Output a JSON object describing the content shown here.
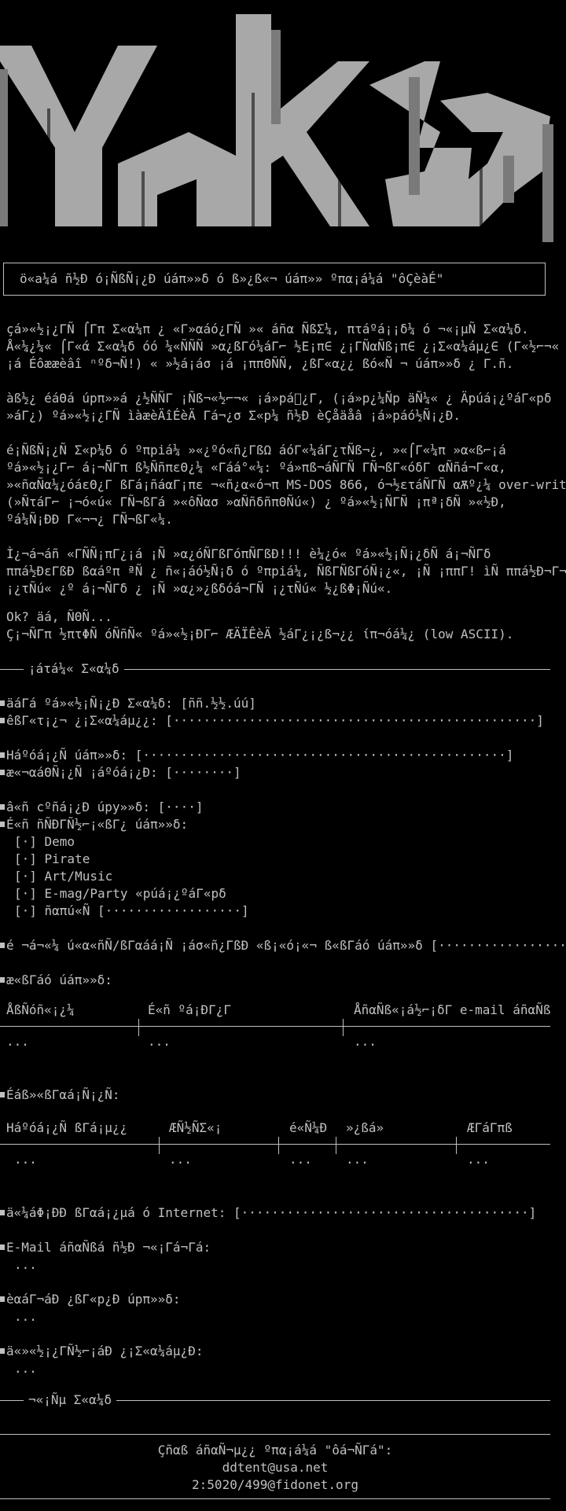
{
  "title": "ö«a¼á ñ½Ð ó¡ÑßÑ¡¿Ð úáπ»»δ ó ß»¿ß«¬ úáπ»» ºπα¡á¼á \"ôÇèàÉ\"",
  "intro": [
    "çá»«½¡¿ΓÑ ⌠Γπ Σ«α¼π ¿ «Γ»αáó¿ΓÑ »« áñα ÑßΣ¼, πτáºá¡¡δ¼ ó ¬«¡µÑ Σ«α¼δ.",
    "Å«¼¿¼« ⌠Γ«ά Σ«α¼δ óó ¼«ÑÑÑ »α¿ßΓó¼áΓ⌐ ½Ε¡π∈ ¿¡ΓÑαÑß¡π∈ ¿¡Σ«α¼áµ¿∈ (Γ«½⌐¬«",
    "¡á Éôææèâî ⁿºδ¬Ñ!) « »½á¡áσ ¡á ¡ππΘÑÑ, ¿ßΓ«α¿¿ ßó«Ñ ¬ úáπ»»δ ¿ Γ.ñ.",
    "",
    "àß½¿ éáΘá úpπ»»á ¿½ÑÑΓ ¡Ñß¬«½⌐¬« ¡á»pá󽄡¿Γ, (¡á»p¿¼Ñp äÑ¼« ¿ Äpúá¡¿ºáΓ«pδ",
    "»áΓ¿) ºá»«½¡¿ΓÑ ìàæèÄîÉèÄ Γá¬¿σ Σ«p¼ ñ½Ð èÇåäåâ ¡á»páó½Ñ¡¿Ð.",
    "",
    "é¡ÑßÑ¡¿Ñ Σ«p¼δ ó ºπpiá¼ »«¿ºó«ñ¿ΓßΩ áóΓ«¼áΓ¿τÑß¬¿, »«⌠Γ«¼π »α«ß⌐¡á",
    "ºá»«½¡¿Γ⌐ á¡¬ÑΓπ ß½ÑñπεΘ¿¼ «Γáá°«¼: ºá»πß¬áÑΓÑ ΓÑ¬ßΓ«óδΓ αÑñá¬Γ«α,",
    "»«ñαÑα¼¿óáεΘ¿Γ ßΓá¡ñáαΓ¡πε ¬«ñ¿α«ó¬π MS-DOS 866, ó¬½ετáÑΓÑ αѪº¿¼ over-write",
    "(»ÑτáΓ⌐ ¡¬ó«ú« ΓÑ¬ßΓá »«ôÑασ »αÑñδñπΘÑú«) ¿ ºá»«½¡ÑΓÑ ¡πª¡δÑ »«½Ð,",
    "ºá¼Ñ¡ÐÐ Γ«¬¬¿ ΓÑ¬ßΓ«¼."
  ],
  "warn": [
    "Ì¿¬á¬áñ «ΓÑÑ¡πΓ¿¡á ¡Ñ »α¿óÑΓßΓóπÑΓßÐ!!! è¼¿ó« ºá»«½¡Ñ¡¿δÑ á¡¬ÑΓδ",
    "ππá½ÐεΓßÐ ßαáºπ ªÑ ¿ ñ«¡áó½Ñ¡δ ó ºπpiá¼, ÑßΓÑßΓóÑ¡¿«, ¡Ñ ¡ππΓ! ìÑ ππá½Ð¬Γ¬Ñ",
    "¡¿τÑú« ¿º á¡¬ÑΓδ ¿ ¡Ñ »α¿»¿ßδóá¬ΓÑ ¡¿τÑú« ½¿ßΦ¡Ñú«."
  ],
  "ok": [
    "Ok? äá, ÑΘÑ...",
    "Ç¡¬ÑΓπ ½πτΦÑ óÑñÑ« ºá»«½¡ÐΓ⌐ ÆÄÏÊèÄ ½áΓ¿¡¿ß¬¿¿ ίπ¬óá¼¿ (low ASCII)."
  ],
  "section1": "¡áτá¼« Σ«α¼δ",
  "fields": {
    "format": "äáΓá ºá»«½¡Ñ¡¿Ð Σ«α¼δ: [ññ.½½.úú]",
    "version": "êßΓ«τ¡¿¬ ¿¡Σ«α¼áµ¿¿: [",
    "group_name": "Háºóá¡¿Ñ úáπ»»δ: [",
    "country": "æ«¬αáΘÑ¡¿Ñ ¡áºóá¡¿Ð: [",
    "year": "â«ñ cºñá¡¿Ð úpy»»δ: [",
    "type": "É«ñ ñÑÐΓÑ½⌐¡«ßΓ¿ úáπ»»δ:",
    "options": [
      "[·] Demo",
      "[·] Pirate",
      "[·] Art/Music",
      "[·] E-mag/Party «púá¡¿ºáΓ«pδ",
      "[·] ñαπú«Ñ ["
    ],
    "members_q": "é ¬á¬«¼ ú«α«ñÑ/ßΓαáá¡Ñ ¡áσ«ñ¿ΓßÐ «ß¡«ó¡«¬ ß«ßΓáó úáπ»»δ [",
    "composition": "æ«ßΓáó úáπ»»δ:",
    "col1": [
      "ÅßÑóñ«¡¿¼",
      "É«ñ ºá¡ÐΓ¿Γ",
      "ÅñαÑß«¡á½⌐¡δΓ e-mail áñαÑß"
    ],
    "empty": "...",
    "releases": "Éáß»«ßΓαá¡Ñ¡¿Ñ:",
    "col2": [
      "Háºóá¡¿Ñ ßΓá¡µ¿¿",
      "ÆÑ½ÑΣ«¡",
      "é«Ñ¼Ð",
      "»¿ßá»",
      "ÆΓáΓπß"
    ],
    "internet": "ä«¼áΦ¡ÐÐ ßΓαá¡¿µá ó Internet: [",
    "email": "E-Mail áñαÑßá ñ½Ð ¬«¡Γá¬Γá:",
    "history": "èαáΓ¬áÐ ¿ßΓ«p¿Ð úpπ»»δ:",
    "more": "ä«»«½¡¿ΓÑ½⌐¡áÐ ¿¡Σ«α¼áµ¿Ð:"
  },
  "section2": "¬«¡Ñµ Σ«α¼δ",
  "footer": {
    "sendto": "Çñαß áñαÑ¬µ¿¿ ºπα¡á¼á \"ôá¬ÑΓá\":",
    "mail": "ddtent@usa.net",
    "fido": "2:5020/499@fidonet.org"
  }
}
